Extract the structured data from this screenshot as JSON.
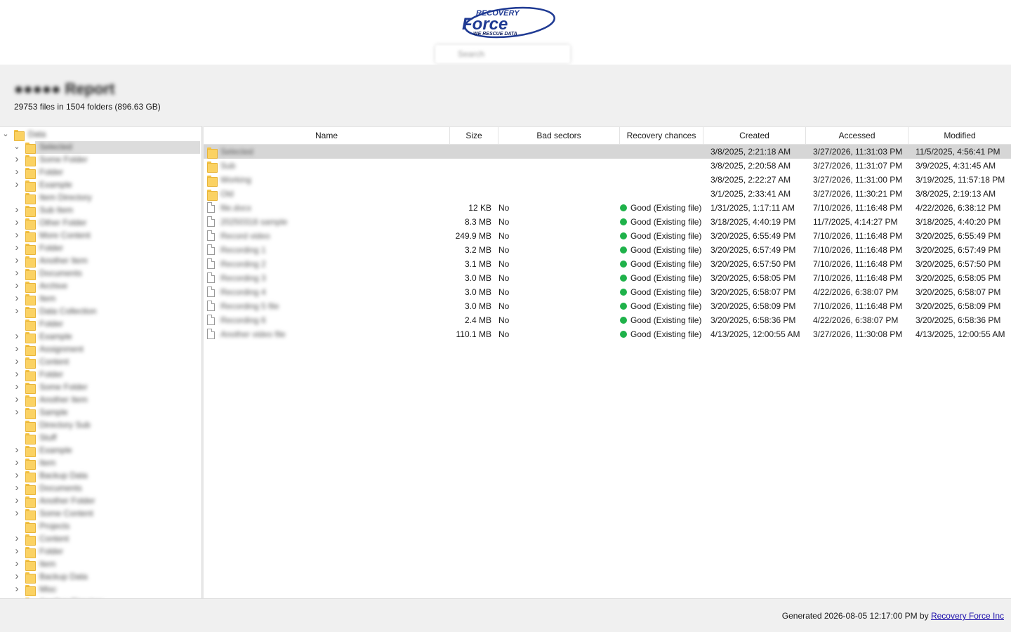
{
  "logo": {
    "line1": "RECOVERY",
    "line2": "Force",
    "line3": "WE RESCUE DATA",
    "colors": {
      "blue": "#1f3a93",
      "navy": "#0f1f5c"
    }
  },
  "search": {
    "placeholder": "Search"
  },
  "report": {
    "title": "●●●●● Report",
    "summary": "29753 files in 1504 folders (896.63 GB)"
  },
  "tree": {
    "root_label": "Data",
    "items": [
      {
        "label": "Selected",
        "expandable": true,
        "expanded": true,
        "selected": true
      },
      {
        "label": "Some Folder",
        "expandable": true
      },
      {
        "label": "Folder",
        "expandable": true
      },
      {
        "label": "Example",
        "expandable": true
      },
      {
        "label": "Item Directory",
        "expandable": false
      },
      {
        "label": "Sub Item",
        "expandable": true
      },
      {
        "label": "Other Folder",
        "expandable": true
      },
      {
        "label": "More Content",
        "expandable": true
      },
      {
        "label": "Folder",
        "expandable": true
      },
      {
        "label": "Another Item",
        "expandable": true
      },
      {
        "label": "Documents",
        "expandable": true
      },
      {
        "label": "Archive",
        "expandable": true
      },
      {
        "label": "Item",
        "expandable": true
      },
      {
        "label": "Data Collection",
        "expandable": true
      },
      {
        "label": "Folder",
        "expandable": false
      },
      {
        "label": "Example",
        "expandable": true
      },
      {
        "label": "Assignment",
        "expandable": true
      },
      {
        "label": "Content",
        "expandable": true
      },
      {
        "label": "Folder",
        "expandable": true
      },
      {
        "label": "Some Folder",
        "expandable": true
      },
      {
        "label": "Another Item",
        "expandable": true
      },
      {
        "label": "Sample",
        "expandable": true
      },
      {
        "label": "Directory Sub",
        "expandable": false
      },
      {
        "label": "Stuff",
        "expandable": false
      },
      {
        "label": "Example",
        "expandable": true
      },
      {
        "label": "Item",
        "expandable": true
      },
      {
        "label": "Backup Data",
        "expandable": true
      },
      {
        "label": "Documents",
        "expandable": true
      },
      {
        "label": "Another Folder",
        "expandable": true
      },
      {
        "label": "Some Content",
        "expandable": true
      },
      {
        "label": "Projects",
        "expandable": false
      },
      {
        "label": "Content",
        "expandable": true
      },
      {
        "label": "Folder",
        "expandable": true
      },
      {
        "label": "Item",
        "expandable": true
      },
      {
        "label": "Backup Data",
        "expandable": true
      },
      {
        "label": "Misc",
        "expandable": true
      },
      {
        "label": "Another Directory",
        "expandable": false
      }
    ]
  },
  "table": {
    "columns": [
      "Name",
      "Size",
      "Bad sectors",
      "Recovery chances",
      "Created",
      "Accessed",
      "Modified"
    ],
    "rows": [
      {
        "kind": "folder",
        "name": "Selected",
        "size": "",
        "bad": "",
        "chance": "",
        "created": "3/8/2025, 2:21:18 AM",
        "accessed": "3/27/2026, 11:31:03 PM",
        "modified": "11/5/2025, 4:56:41 PM",
        "selected": true
      },
      {
        "kind": "folder",
        "name": "Sub",
        "size": "",
        "bad": "",
        "chance": "",
        "created": "3/8/2025, 2:20:58 AM",
        "accessed": "3/27/2026, 11:31:07 PM",
        "modified": "3/9/2025, 4:31:45 AM"
      },
      {
        "kind": "folder",
        "name": "Working",
        "size": "",
        "bad": "",
        "chance": "",
        "created": "3/8/2025, 2:22:27 AM",
        "accessed": "3/27/2026, 11:31:00 PM",
        "modified": "3/19/2025, 11:57:18 PM"
      },
      {
        "kind": "folder",
        "name": "Old",
        "size": "",
        "bad": "",
        "chance": "",
        "created": "3/1/2025, 2:33:41 AM",
        "accessed": "3/27/2026, 11:30:21 PM",
        "modified": "3/8/2025, 2:19:13 AM"
      },
      {
        "kind": "file",
        "name": "file.docx",
        "size": "12 KB",
        "bad": "No",
        "chance": "Good (Existing file)",
        "created": "1/31/2025, 1:17:11 AM",
        "accessed": "7/10/2026, 11:16:48 PM",
        "modified": "4/22/2026, 6:38:12 PM"
      },
      {
        "kind": "file",
        "name": "20250318 sample",
        "size": "8.3 MB",
        "bad": "No",
        "chance": "Good (Existing file)",
        "created": "3/18/2025, 4:40:19 PM",
        "accessed": "11/7/2025, 4:14:27 PM",
        "modified": "3/18/2025, 4:40:20 PM"
      },
      {
        "kind": "file",
        "name": "Record video",
        "size": "249.9 MB",
        "bad": "No",
        "chance": "Good (Existing file)",
        "created": "3/20/2025, 6:55:49 PM",
        "accessed": "7/10/2026, 11:16:48 PM",
        "modified": "3/20/2025, 6:55:49 PM"
      },
      {
        "kind": "file",
        "name": "Recording 1",
        "size": "3.2 MB",
        "bad": "No",
        "chance": "Good (Existing file)",
        "created": "3/20/2025, 6:57:49 PM",
        "accessed": "7/10/2026, 11:16:48 PM",
        "modified": "3/20/2025, 6:57:49 PM"
      },
      {
        "kind": "file",
        "name": "Recording 2",
        "size": "3.1 MB",
        "bad": "No",
        "chance": "Good (Existing file)",
        "created": "3/20/2025, 6:57:50 PM",
        "accessed": "7/10/2026, 11:16:48 PM",
        "modified": "3/20/2025, 6:57:50 PM"
      },
      {
        "kind": "file",
        "name": "Recording 3",
        "size": "3.0 MB",
        "bad": "No",
        "chance": "Good (Existing file)",
        "created": "3/20/2025, 6:58:05 PM",
        "accessed": "7/10/2026, 11:16:48 PM",
        "modified": "3/20/2025, 6:58:05 PM"
      },
      {
        "kind": "file",
        "name": "Recording 4",
        "size": "3.0 MB",
        "bad": "No",
        "chance": "Good (Existing file)",
        "created": "3/20/2025, 6:58:07 PM",
        "accessed": "4/22/2026, 6:38:07 PM",
        "modified": "3/20/2025, 6:58:07 PM"
      },
      {
        "kind": "file",
        "name": "Recording 5 file",
        "size": "3.0 MB",
        "bad": "No",
        "chance": "Good (Existing file)",
        "created": "3/20/2025, 6:58:09 PM",
        "accessed": "7/10/2026, 11:16:48 PM",
        "modified": "3/20/2025, 6:58:09 PM"
      },
      {
        "kind": "file",
        "name": "Recording 6",
        "size": "2.4 MB",
        "bad": "No",
        "chance": "Good (Existing file)",
        "created": "3/20/2025, 6:58:36 PM",
        "accessed": "4/22/2026, 6:38:07 PM",
        "modified": "3/20/2025, 6:58:36 PM"
      },
      {
        "kind": "file",
        "name": "Another video file",
        "size": "110.1 MB",
        "bad": "No",
        "chance": "Good (Existing file)",
        "created": "4/13/2025, 12:00:55 AM",
        "accessed": "3/27/2026, 11:30:08 PM",
        "modified": "4/13/2025, 12:00:55 AM"
      }
    ],
    "status_color": "#1fb24a"
  },
  "footer": {
    "generated": "Generated 2026-08-05 12:17:00 PM by",
    "link_text": "Recovery Force Inc"
  }
}
